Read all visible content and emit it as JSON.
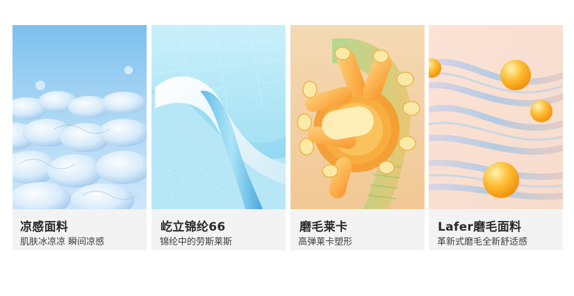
{
  "cards": [
    {
      "title": "凉感面料",
      "subtitle": "肌肤冰凉凉 瞬间凉感",
      "image": "cool-knit-fabric-illustration"
    },
    {
      "title": "屹立锦纶66",
      "subtitle": "锦纶中的劳斯莱斯",
      "image": "nylon-wave-fabric-illustration"
    },
    {
      "title": "磨毛莱卡",
      "subtitle": "高弹莱卡塑形",
      "image": "lycra-fiber-coil-illustration"
    },
    {
      "title": "Lafer磨毛面料",
      "subtitle": "革新式磨毛全新舒适感",
      "image": "lafer-ribbon-sphere-illustration"
    }
  ],
  "colors": {
    "caption_bg": "#f3f3f3",
    "title": "#2a2a2a",
    "subtitle": "#3d3d3d"
  }
}
